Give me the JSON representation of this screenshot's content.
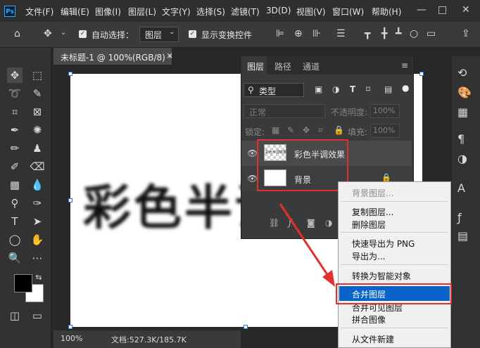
{
  "app": {
    "logo": "Ps"
  },
  "menu": [
    "文件(F)",
    "编辑(E)",
    "图像(I)",
    "图层(L)",
    "文字(Y)",
    "选择(S)",
    "滤镜(T)",
    "3D(D)",
    "视图(V)",
    "窗口(W)",
    "帮助(H)"
  ],
  "window_controls": {
    "minimize": "—",
    "restore": "□",
    "close": "✕"
  },
  "options": {
    "auto_select_label": "自动选择：",
    "auto_select_value": "图层",
    "show_transform_label": "显示变换控件"
  },
  "document": {
    "tab_label": "未标题-1 @ 100%(RGB/8) *",
    "close_symbol": "×",
    "canvas_text": "彩色半调",
    "zoom": "100%",
    "doc_size": "文档:527.3K/185.7K"
  },
  "layers_panel": {
    "tabs": [
      "图层",
      "路径",
      "通道"
    ],
    "filter_kind": "类型",
    "blend_mode": "正常",
    "opacity_label": "不透明度:",
    "opacity_value": "100%",
    "lock_label": "锁定:",
    "fill_label": "填充:",
    "fill_value": "100%",
    "layers": [
      {
        "name": "彩色半调效果",
        "thumb_text": "彩色半调效果"
      },
      {
        "name": "背景"
      }
    ]
  },
  "context_menu": {
    "items": [
      {
        "label": "背景图层...",
        "disabled": true
      },
      {
        "label": "复制图层...",
        "disabled": false
      },
      {
        "label": "删除图层",
        "disabled": false
      },
      {
        "label": "快速导出为 PNG",
        "disabled": false
      },
      {
        "label": "导出为...",
        "disabled": false
      },
      {
        "label": "转换为智能对象",
        "disabled": false
      },
      {
        "label": "合并图层",
        "disabled": false,
        "highlighted": true
      },
      {
        "label": "合并可见图层",
        "disabled": false
      },
      {
        "label": "拼合图像",
        "disabled": false
      },
      {
        "label": "从文件新建",
        "disabled": false
      }
    ]
  },
  "colors": {
    "accent_red": "#e03030",
    "highlight_blue": "#0a64c8"
  }
}
